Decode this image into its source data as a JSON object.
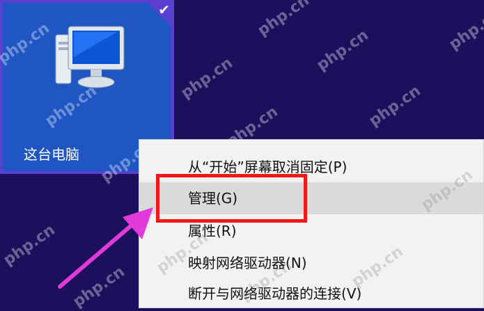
{
  "tile": {
    "label": "这台电脑",
    "check": "✔"
  },
  "menu": {
    "items": [
      {
        "label": "从“开始”屏幕取消固定(P)"
      },
      {
        "label": "管理(G)"
      },
      {
        "label": "属性(R)"
      },
      {
        "label": "映射网络驱动器(N)"
      },
      {
        "label": "断开与网络驱动器的连接(V)"
      }
    ]
  },
  "watermark": {
    "text": "php.cn"
  },
  "colors": {
    "desktop": "#1c0f5c",
    "tile": "#1f56c3",
    "highlight": "#f01818",
    "arrow": "#e03ad9"
  }
}
